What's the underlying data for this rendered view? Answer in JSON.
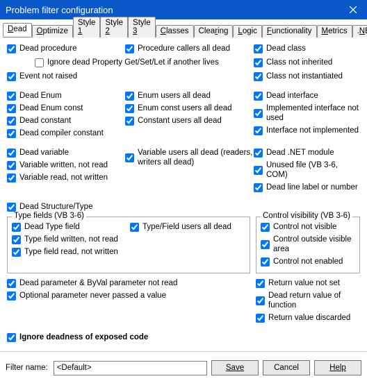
{
  "window": {
    "title": "Problem filter configuration"
  },
  "tabs": [
    {
      "label": "Dead",
      "accel": 0
    },
    {
      "label": "Optimize",
      "accel": 0
    },
    {
      "label": "Style 1",
      "accel": 6
    },
    {
      "label": "Style 2",
      "accel": 6
    },
    {
      "label": "Style 3",
      "accel": 6
    },
    {
      "label": "Classes",
      "accel": 0
    },
    {
      "label": "Clearing",
      "accel": 4
    },
    {
      "label": "Logic",
      "accel": 0
    },
    {
      "label": "Functionality",
      "accel": 0
    },
    {
      "label": "Metrics",
      "accel": 0
    },
    {
      "label": ".NET",
      "accel": 1
    }
  ],
  "section1": {
    "col1": [
      {
        "label": "Dead procedure",
        "checked": true
      },
      {
        "label": "Ignore dead Property Get/Set/Let if another lives",
        "checked": false,
        "sub": true
      },
      {
        "label": "Event not raised",
        "checked": true
      }
    ],
    "col2": [
      {
        "label": "Procedure callers all dead",
        "checked": true
      }
    ],
    "col3": [
      {
        "label": "Dead class",
        "checked": true
      },
      {
        "label": "Class not inherited",
        "checked": true
      },
      {
        "label": "Class not instantiated",
        "checked": true
      }
    ]
  },
  "section2": {
    "col1": [
      {
        "label": "Dead Enum",
        "checked": true
      },
      {
        "label": "Dead Enum const",
        "checked": true
      },
      {
        "label": "Dead constant",
        "checked": true
      },
      {
        "label": "Dead compiler constant",
        "checked": true
      }
    ],
    "col2": [
      {
        "label": "Enum users all dead",
        "checked": true
      },
      {
        "label": "Enum const users all dead",
        "checked": true
      },
      {
        "label": "Constant users all dead",
        "checked": true
      }
    ],
    "col3": [
      {
        "label": "Dead interface",
        "checked": true
      },
      {
        "label": "Implemented interface not used",
        "checked": true
      },
      {
        "label": "Interface not implemented",
        "checked": true
      }
    ]
  },
  "section3": {
    "col1": [
      {
        "label": "Dead variable",
        "checked": true
      },
      {
        "label": "Variable written, not read",
        "checked": true
      },
      {
        "label": "Variable read, not written",
        "checked": true
      }
    ],
    "col2": [
      {
        "label": "Variable users all dead (readers, writers all dead)",
        "checked": true
      }
    ],
    "col3": [
      {
        "label": "Dead .NET module",
        "checked": true
      },
      {
        "label": "Unused file (VB 3-6, COM)",
        "checked": true
      },
      {
        "label": "Dead line label or number",
        "checked": true
      }
    ]
  },
  "section4": {
    "col1": [
      {
        "label": "Dead Structure/Type",
        "checked": true
      }
    ]
  },
  "group_type": {
    "title": "Type fields (VB 3-6)",
    "col1": [
      {
        "label": "Dead Type field",
        "checked": true
      },
      {
        "label": "Type field written, not read",
        "checked": true
      },
      {
        "label": "Type field read, not written",
        "checked": true
      }
    ],
    "col2": [
      {
        "label": "Type/Field users all dead",
        "checked": true
      }
    ]
  },
  "group_ctrl": {
    "title": "Control visibility (VB 3-6)",
    "items": [
      {
        "label": "Control not visible",
        "checked": true
      },
      {
        "label": "Control outside visible area",
        "checked": true
      },
      {
        "label": "Control not enabled",
        "checked": true
      }
    ]
  },
  "section5": {
    "colL": [
      {
        "label": "Dead parameter & ByVal parameter not read",
        "checked": true
      },
      {
        "label": "Optional parameter never passed a value",
        "checked": true
      }
    ],
    "colR": [
      {
        "label": "Return value not set",
        "checked": true
      },
      {
        "label": "Dead return value of function",
        "checked": true
      },
      {
        "label": "Return value discarded",
        "checked": true
      }
    ]
  },
  "ignore_exposed": {
    "label": "Ignore deadness of exposed code",
    "checked": true
  },
  "bottom": {
    "filter_label": "Filter name:",
    "filter_value": "<Default>",
    "save": "Save",
    "cancel": "Cancel",
    "help": "Help"
  }
}
